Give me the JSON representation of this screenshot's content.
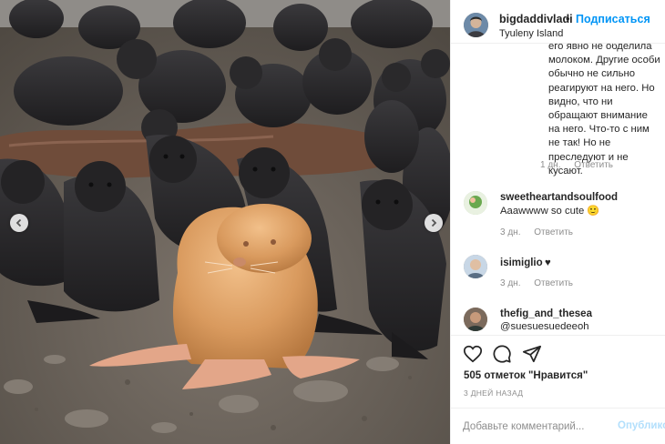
{
  "post": {
    "username": "bigdaddivladi",
    "separator": "•",
    "follow_label": "Подписаться",
    "location": "Tyuleny Island"
  },
  "caption": {
    "text": "его явно не обделила молоком. Другие особи обычно не сильно реагируют на него. Но видно, что ни обращают внимание на него. Что-то с ним не так! Но не преследуют и не кусают.",
    "time": "1 дн.",
    "reply_label": "Ответить"
  },
  "comments": [
    {
      "username": "sweetheartandsoulfood",
      "text": "Aaawwww so cute 🙂",
      "time": "3 дн.",
      "reply_label": "Ответить"
    },
    {
      "username": "isimiglio",
      "text": "♥",
      "time": "3 дн.",
      "reply_label": "Ответить"
    },
    {
      "username": "thefig_and_thesea",
      "text": "@suesuesuedeeoh"
    }
  ],
  "actions": {
    "likes_text": "505 отметок \"Нравится\"",
    "date_text": "3 ДНЕЙ НАЗАД",
    "icons": [
      "heart-icon",
      "comment-icon",
      "share-icon"
    ]
  },
  "add_comment": {
    "placeholder": "Добавьте комментарий...",
    "publish_label": "Опубликовать"
  },
  "colors": {
    "link_blue": "#0095f6",
    "publish_disabled": "#b2dffc",
    "secondary_text": "#8e8e8e",
    "border": "#efefef",
    "seal_dark": "#2b2a2c",
    "albino_seal": "#d99a5e"
  },
  "photo": {
    "icons": [
      "chevron-left-icon",
      "chevron-right-icon"
    ]
  }
}
